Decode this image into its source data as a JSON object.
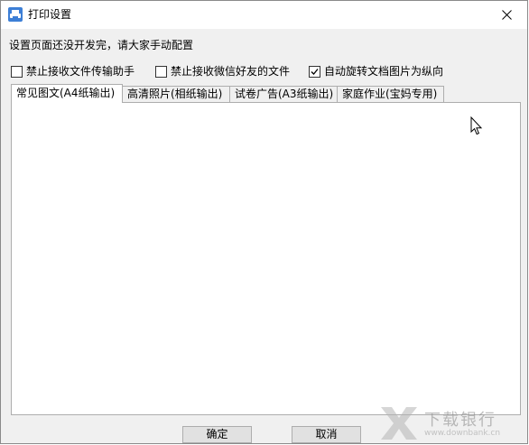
{
  "window": {
    "title": "打印设置",
    "icon": "printer-app-icon",
    "close_icon": "close-icon"
  },
  "notice": "设置页面还没开发完，请大家手动配置",
  "options": [
    {
      "label": "禁止接收文件传输助手",
      "checked": false
    },
    {
      "label": "禁止接收微信好友的文件",
      "checked": false
    },
    {
      "label": "自动旋转文档图片为纵向",
      "checked": true
    }
  ],
  "tabs": [
    {
      "label": "常见图文(A4纸输出)",
      "active": true
    },
    {
      "label": "高清照片(相纸输出)",
      "active": false
    },
    {
      "label": "试卷广告(A3纸输出)",
      "active": false
    },
    {
      "label": "家庭作业(宝妈专用)",
      "active": false
    }
  ],
  "buttons": {
    "confirm": "确定",
    "cancel": "取消"
  },
  "watermark": {
    "text": "下载银行",
    "sub": "www.downbank.cn"
  },
  "colors": {
    "dialog_bg": "#f0f0f0",
    "panel_bg": "#ffffff",
    "border": "#adadad"
  }
}
